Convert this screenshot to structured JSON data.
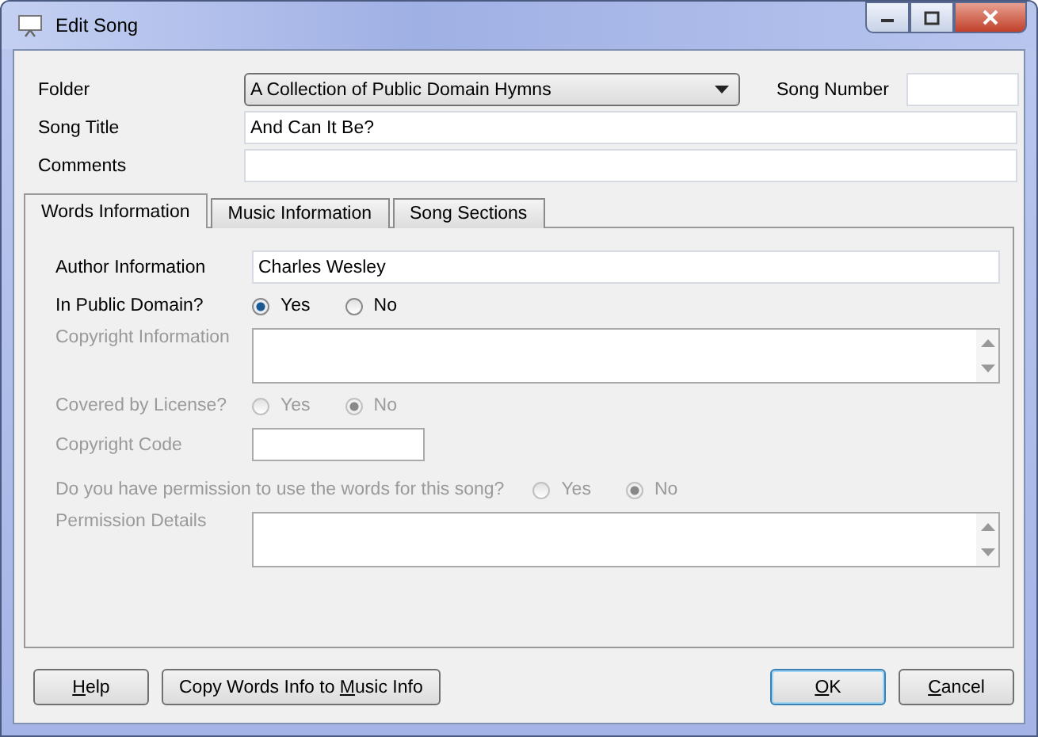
{
  "window": {
    "title": "Edit Song"
  },
  "header": {
    "folder": {
      "label": "Folder",
      "value": "A Collection of Public Domain Hymns"
    },
    "song_number": {
      "label": "Song Number"
    },
    "song_title": {
      "label": "Song Title",
      "value": "And Can It Be?"
    },
    "comments": {
      "label": "Comments"
    }
  },
  "tabs": [
    {
      "label": "Words Information",
      "selected": true
    },
    {
      "label": "Music Information",
      "selected": false
    },
    {
      "label": "Song Sections",
      "selected": false
    }
  ],
  "fields": [
    {
      "kind": "text",
      "label": "Author Information",
      "value": "Charles Wesley",
      "disabled": false
    },
    {
      "kind": "radio",
      "label": "In Public Domain?",
      "disabled": false,
      "options": [
        {
          "label": "Yes",
          "selected": true
        },
        {
          "label": "No",
          "selected": false
        }
      ]
    },
    {
      "kind": "textarea",
      "label": "Copyright Information",
      "disabled": true
    },
    {
      "kind": "radio",
      "label": "Covered by License?",
      "disabled": true,
      "options": [
        {
          "label": "Yes",
          "selected": false
        },
        {
          "label": "No",
          "selected": true
        }
      ]
    },
    {
      "kind": "short",
      "label": "Copyright Code",
      "disabled": true
    },
    {
      "kind": "radio-wide",
      "label": "Do you have permission to use the words for this song?",
      "disabled": true,
      "options": [
        {
          "label": "Yes",
          "selected": false
        },
        {
          "label": "No",
          "selected": true
        }
      ]
    },
    {
      "kind": "textarea",
      "label": "Permission Details",
      "disabled": true
    }
  ],
  "left_buttons": [
    {
      "key": "H",
      "post": "elp",
      "default": false
    },
    {
      "pre": "Copy Words Info to ",
      "key": "M",
      "post": "usic Info",
      "default": false
    }
  ],
  "right_buttons": [
    {
      "key": "O",
      "post": "K",
      "default": true
    },
    {
      "key": "C",
      "post": "ancel",
      "default": false
    }
  ]
}
